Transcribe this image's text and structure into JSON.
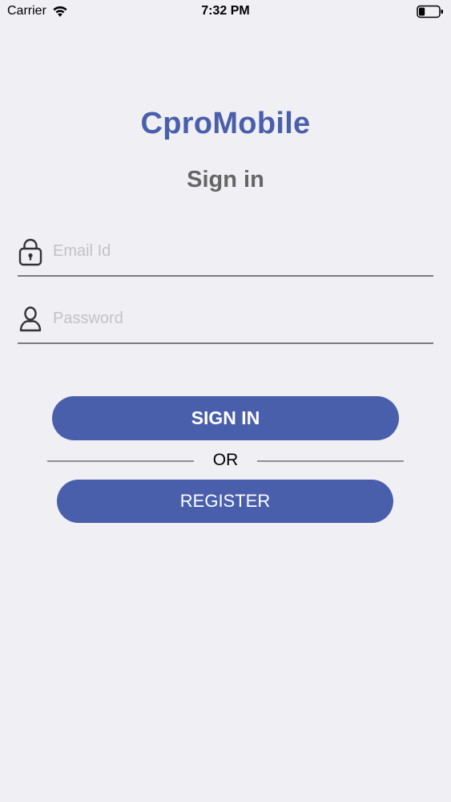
{
  "status_bar": {
    "carrier": "Carrier",
    "time": "7:32 PM",
    "battery_level": 0.3
  },
  "app": {
    "title": "CproMobile",
    "heading": "Sign in"
  },
  "form": {
    "email": {
      "placeholder": "Email Id",
      "value": "",
      "icon": "lock-icon"
    },
    "password": {
      "placeholder": "Password",
      "value": "",
      "icon": "user-icon"
    }
  },
  "actions": {
    "signin_label": "SIGN IN",
    "or_label": "OR",
    "register_label": "REGISTER"
  },
  "colors": {
    "accent": "#4a5fac",
    "background": "#efeff4",
    "heading": "#666666",
    "placeholder": "#c2c2c7"
  }
}
